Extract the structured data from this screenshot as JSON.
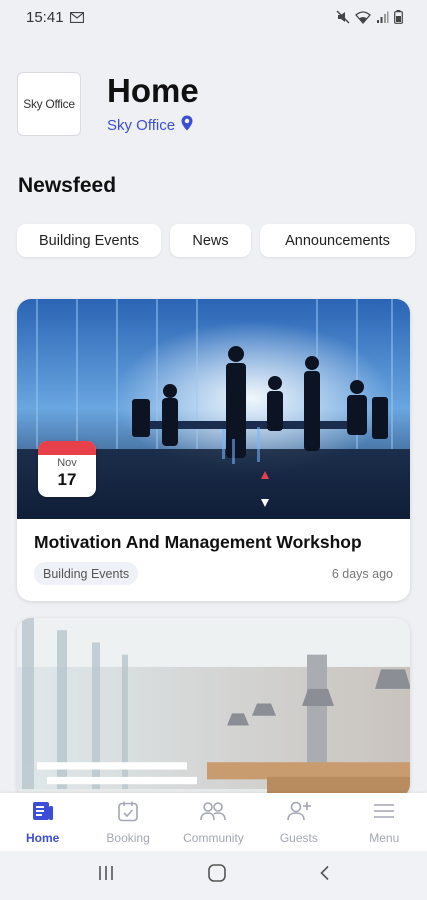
{
  "status_bar": {
    "time": "15:41"
  },
  "header": {
    "logo_text": "Sky Office",
    "title": "Home",
    "location": "Sky Office"
  },
  "newsfeed": {
    "title": "Newsfeed",
    "filters": [
      "Building Events",
      "News",
      "Announcements"
    ]
  },
  "cards": [
    {
      "date_month": "Nov",
      "date_day": "17",
      "title": "Motivation And Management Workshop",
      "tag": "Building Events",
      "time_ago": "6 days ago"
    },
    {}
  ],
  "bottom_nav": {
    "items": [
      {
        "label": "Home",
        "icon": "home-icon",
        "active": true
      },
      {
        "label": "Booking",
        "icon": "calendar-check-icon",
        "active": false
      },
      {
        "label": "Community",
        "icon": "people-icon",
        "active": false
      },
      {
        "label": "Guests",
        "icon": "add-person-icon",
        "active": false
      },
      {
        "label": "Menu",
        "icon": "hamburger-menu-icon",
        "active": false
      }
    ]
  },
  "colors": {
    "accent": "#3d4ed6",
    "background": "#eef0f4",
    "date_badge_red": "#e8404a",
    "inactive_nav": "#a3a7b2"
  }
}
